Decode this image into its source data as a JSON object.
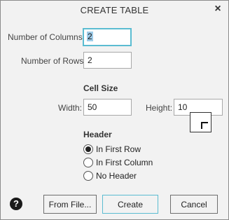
{
  "dialog": {
    "title": "CREATE TABLE",
    "close_glyph": "×"
  },
  "fields": {
    "columns_label": "Number of Columns:",
    "columns_value": "2",
    "rows_label": "Number of Rows:",
    "rows_value": "2"
  },
  "cell_size": {
    "heading": "Cell Size",
    "width_label": "Width:",
    "width_value": "50",
    "height_label": "Height:",
    "height_value": "10"
  },
  "header": {
    "heading": "Header",
    "options": [
      {
        "label": "In First Row",
        "checked": true
      },
      {
        "label": "In First Column",
        "checked": false
      },
      {
        "label": "No Header",
        "checked": false
      }
    ]
  },
  "buttons": {
    "help_glyph": "?",
    "from_file": "From File...",
    "create": "Create",
    "cancel": "Cancel"
  },
  "icons": {
    "close": "close-icon",
    "help": "help-icon",
    "cell_picker": "cell-size-picker-icon"
  },
  "colors": {
    "focus_accent": "#5bbcd1",
    "selection": "#9ecbe8"
  }
}
